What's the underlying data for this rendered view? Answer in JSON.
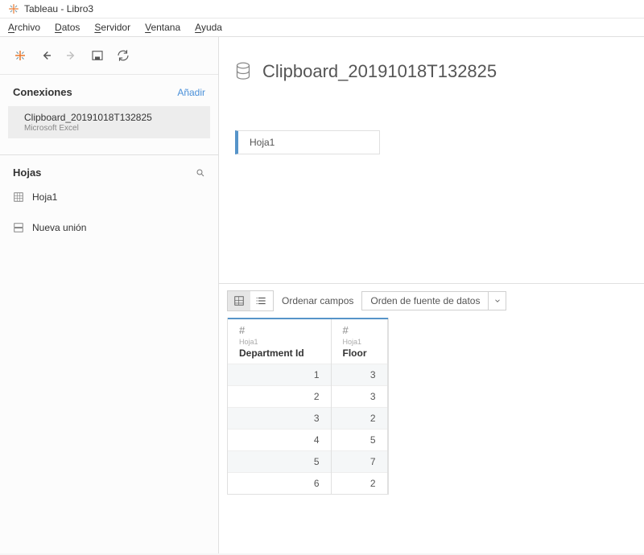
{
  "window": {
    "title": "Tableau - Libro3"
  },
  "menu": {
    "archivo": "Archivo",
    "datos": "Datos",
    "servidor": "Servidor",
    "ventana": "Ventana",
    "ayuda": "Ayuda"
  },
  "sidebar": {
    "connections_header": "Conexiones",
    "add_link": "Añadir",
    "connection": {
      "name": "Clipboard_20191018T132825",
      "type": "Microsoft Excel"
    },
    "sheets_header": "Hojas",
    "sheet_items": [
      {
        "label": "Hoja1"
      }
    ],
    "new_union": "Nueva unión"
  },
  "datasource": {
    "title": "Clipboard_20191018T132825"
  },
  "canvas": {
    "sheet_block": "Hoja1"
  },
  "grid": {
    "sort_label": "Ordenar campos",
    "sort_value": "Orden de fuente de datos",
    "columns": [
      {
        "type": "#",
        "source": "Hoja1",
        "name": "Department Id"
      },
      {
        "type": "#",
        "source": "Hoja1",
        "name": "Floor"
      }
    ],
    "rows": [
      {
        "dept": "1",
        "floor": "3"
      },
      {
        "dept": "2",
        "floor": "3"
      },
      {
        "dept": "3",
        "floor": "2"
      },
      {
        "dept": "4",
        "floor": "5"
      },
      {
        "dept": "5",
        "floor": "7"
      },
      {
        "dept": "6",
        "floor": "2"
      }
    ]
  }
}
